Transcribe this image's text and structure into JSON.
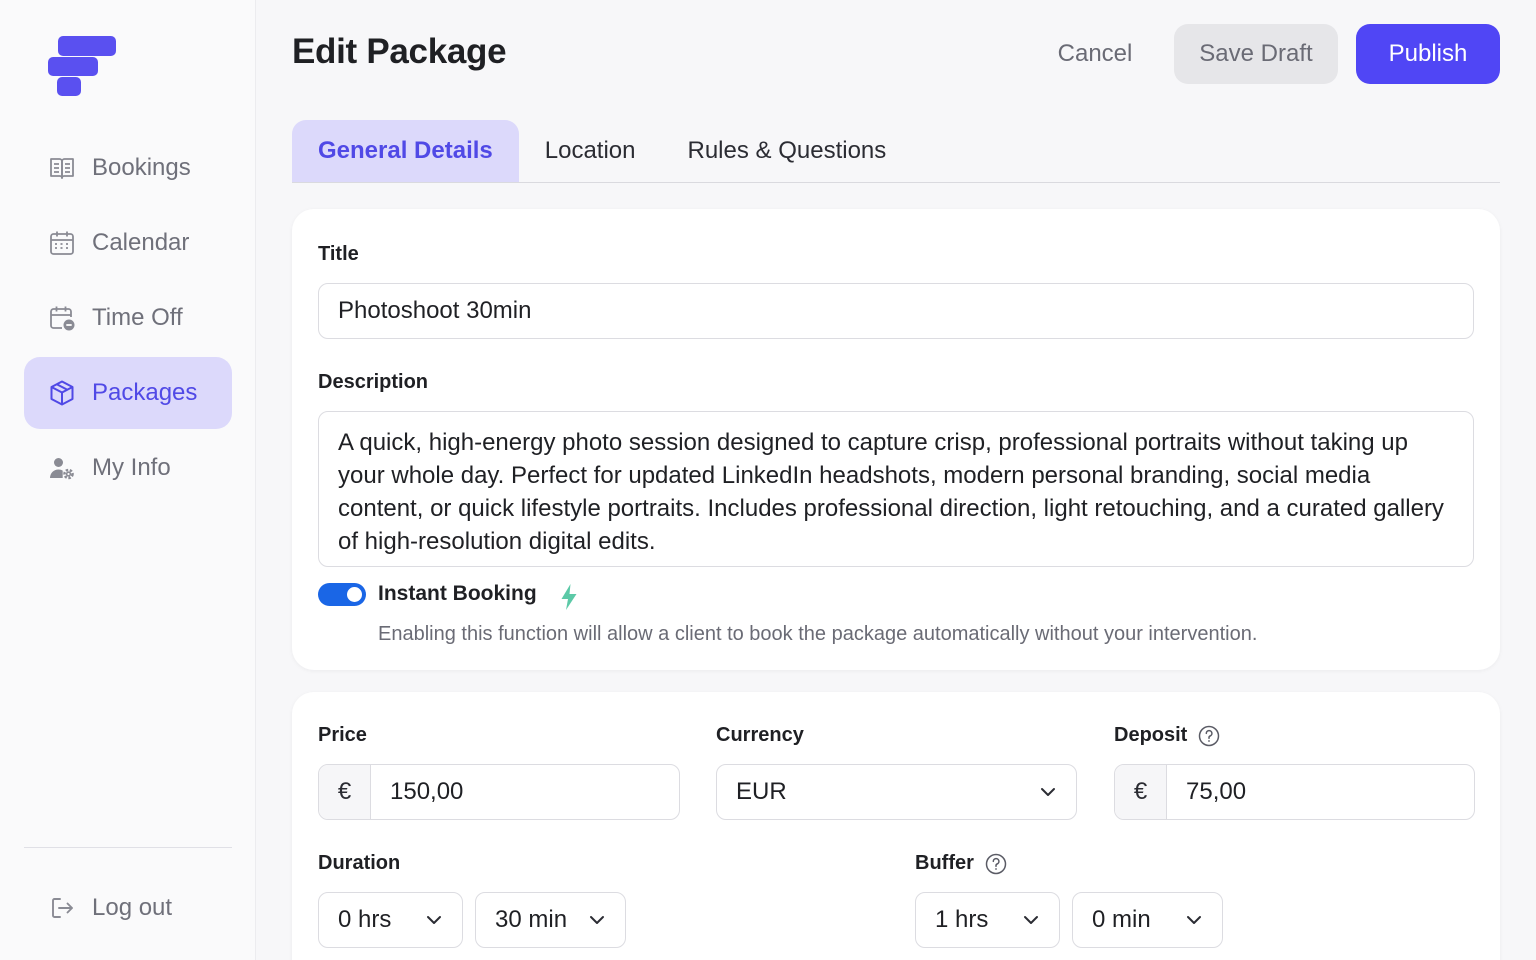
{
  "header": {
    "title": "Edit Package",
    "cancel_label": "Cancel",
    "save_draft_label": "Save Draft",
    "publish_label": "Publish"
  },
  "sidebar": {
    "items": [
      {
        "label": "Bookings",
        "icon": "book-icon"
      },
      {
        "label": "Calendar",
        "icon": "calendar-icon"
      },
      {
        "label": "Time Off",
        "icon": "calendar-minus-icon"
      },
      {
        "label": "Packages",
        "icon": "package-icon",
        "active": true
      },
      {
        "label": "My Info",
        "icon": "user-gear-icon"
      }
    ],
    "logout_label": "Log out"
  },
  "tabs": [
    {
      "label": "General Details",
      "active": true
    },
    {
      "label": "Location"
    },
    {
      "label": "Rules & Questions"
    }
  ],
  "form": {
    "title_label": "Title",
    "title_value": "Photoshoot 30min",
    "description_label": "Description",
    "description_value": "A quick, high-energy photo session designed to capture crisp, professional portraits without taking up your whole day. Perfect for updated LinkedIn headshots, modern personal branding, social media content, or quick lifestyle portraits. Includes professional direction, light retouching, and a curated gallery of high-resolution digital edits.",
    "instant_booking_label": "Instant Booking",
    "instant_booking_enabled": true,
    "instant_booking_help": "Enabling this function will allow a client to book the package automatically without your intervention.",
    "price_label": "Price",
    "price_prefix": "€",
    "price_value": "150,00",
    "currency_label": "Currency",
    "currency_value": "EUR",
    "deposit_label": "Deposit",
    "deposit_prefix": "€",
    "deposit_value": "75,00",
    "duration_label": "Duration",
    "duration_hours": "0 hrs",
    "duration_minutes": "30 min",
    "buffer_label": "Buffer",
    "buffer_hours": "1 hrs",
    "buffer_minutes": "0 min"
  },
  "colors": {
    "accent": "#5046f5",
    "accent_soft": "#dcd9fb",
    "toggle_on": "#1a66e6",
    "bolt": "#5cc9a7"
  }
}
